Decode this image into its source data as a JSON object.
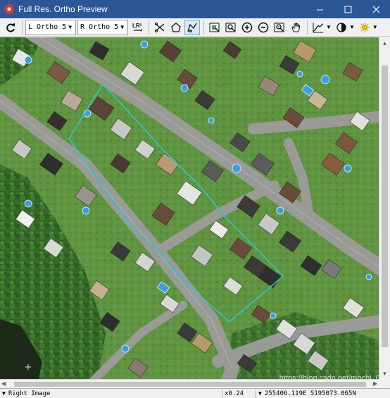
{
  "window": {
    "title": "Full Res. Ortho Preview",
    "icons": [
      "app-icon",
      "minimize-icon",
      "maximize-icon",
      "close-icon"
    ]
  },
  "toolbar": {
    "left_image_label": "L Ortho 5",
    "right_image_label": "R Ortho 5",
    "swap_label": "LR",
    "tools": [
      "refresh-icon",
      "swap-images-icon",
      "cut-seamline-icon",
      "polygon-icon",
      "edit-seamline-icon",
      "zoom-to-extent-icon",
      "zoom-to-layer-icon",
      "zoom-in-icon",
      "zoom-out-icon",
      "zoom-window-icon",
      "pan-icon",
      "graph-adjust-icon",
      "contrast-icon",
      "brightness-icon"
    ]
  },
  "viewport": {
    "accent_polygon_color": "#31c4cf"
  },
  "statusbar": {
    "image_label": "Right Image",
    "zoom": "x0.24",
    "coordinates": "255406.119E 5195073.065N"
  },
  "watermark": "https://blog.csdn.net/mochi_09"
}
